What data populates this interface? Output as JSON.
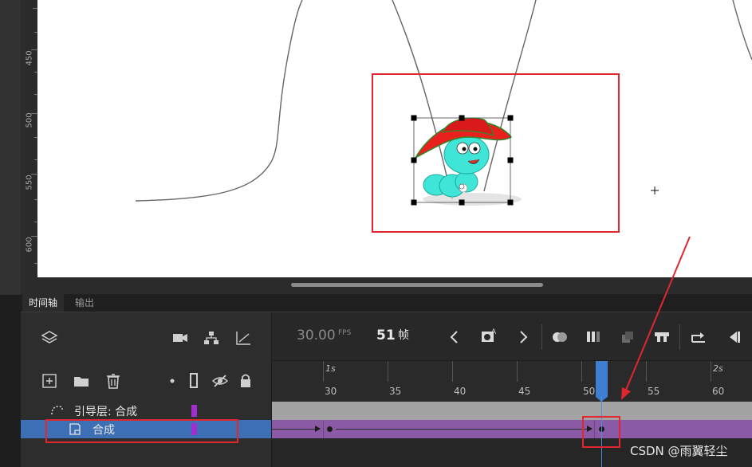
{
  "ruler": {
    "labels": [
      "450",
      "500",
      "550",
      "600"
    ]
  },
  "tabs": {
    "timeline": "时间轴",
    "output": "输出"
  },
  "controls": {
    "fps": "30.00",
    "fps_unit": "FPS",
    "frame": "51",
    "frame_unit": "帧"
  },
  "frame_ruler": {
    "seconds": [
      "1s",
      "2s"
    ],
    "numbers": [
      "30",
      "35",
      "40",
      "45",
      "50",
      "55",
      "60"
    ]
  },
  "layers": [
    {
      "name": "引导层: 合成",
      "color": "#a02fd0"
    },
    {
      "name": "合成",
      "color": "#a02fd0"
    }
  ],
  "current_frame": 51,
  "colors": {
    "highlight_box": "#e0262e",
    "selected_row": "#3d6fb5",
    "layer_track": "#8a5aa7",
    "playhead": "#3f7fd2"
  },
  "icons": [
    "layers-icon",
    "camera-icon",
    "hierarchy-icon",
    "graph-icon",
    "prev-frame-icon",
    "insert-keyframe-icon",
    "next-frame-icon",
    "onion-skin-icon",
    "onion-outline-icon",
    "edit-multiple-frames-icon",
    "loop-icon",
    "sync-icon",
    "step-back-icon",
    "new-layer-icon",
    "new-folder-icon",
    "delete-icon",
    "show-all-icon",
    "outline-icon",
    "hide-icon",
    "lock-icon"
  ],
  "watermark": "CSDN @雨翼轻尘"
}
